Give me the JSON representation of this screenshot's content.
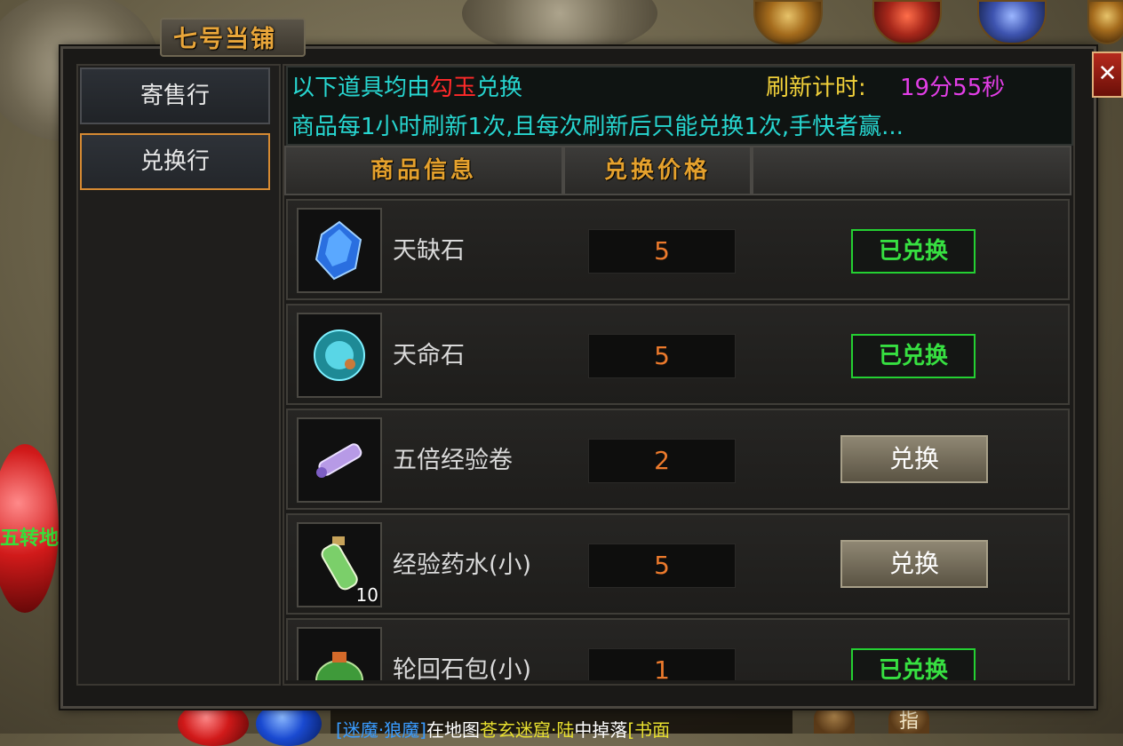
{
  "window": {
    "title": "七号当铺",
    "close_label": "✕"
  },
  "sidebar": {
    "tabs": [
      {
        "label": "寄售行",
        "active": false
      },
      {
        "label": "兑换行",
        "active": true
      }
    ]
  },
  "info": {
    "line1_prefix": "以下道具均由",
    "currency": "勾玉",
    "line1_suffix": "兑换",
    "timer_label": "刷新计时:",
    "timer_value": "19分55秒",
    "line2": "商品每1小时刷新1次,且每次刷新后只能兑换1次,手快者赢..."
  },
  "table": {
    "headers": [
      "商品信息",
      "兑换价格"
    ],
    "rows": [
      {
        "name": "天缺石",
        "price": "5",
        "status": "已兑换",
        "redeemed": true,
        "icon": "blue-gem-icon",
        "qty": ""
      },
      {
        "name": "天命石",
        "price": "5",
        "status": "已兑换",
        "redeemed": true,
        "icon": "cyan-gem-icon",
        "qty": ""
      },
      {
        "name": "五倍经验卷",
        "price": "2",
        "status": "兑换",
        "redeemed": false,
        "icon": "scroll-icon",
        "qty": ""
      },
      {
        "name": "经验药水(小)",
        "price": "5",
        "status": "兑换",
        "redeemed": false,
        "icon": "potion-icon",
        "qty": "10"
      },
      {
        "name": "轮回石包(小)",
        "price": "1",
        "status": "已兑换",
        "redeemed": true,
        "icon": "bag-icon",
        "qty": ""
      }
    ]
  },
  "background": {
    "left_text": "五转地",
    "chat_a": "[迷魔·狼魔]",
    "chat_b": "在地图",
    "chat_c": "苍玄迷窟·陆",
    "chat_d": "中掉落",
    "chat_e": "[书面",
    "bottom_btn": "指"
  },
  "colors": {
    "title": "#e9a63a",
    "cyan_text": "#27d6d0",
    "currency": "#ff2a2a",
    "timer": "#e23ee6",
    "price": "#ec7a2c",
    "redeemed_green": "#37e041"
  }
}
